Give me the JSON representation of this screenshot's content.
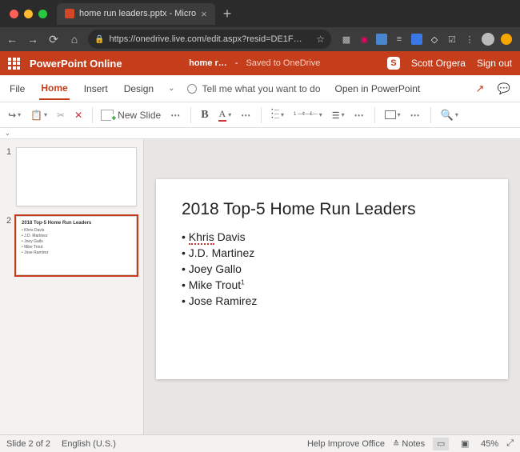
{
  "browser": {
    "tab_title": "home run leaders.pptx - Micro",
    "url": "https://onedrive.live.com/edit.aspx?resid=DE1F…"
  },
  "app": {
    "name": "PowerPoint Online",
    "doc_name": "home r…",
    "save_dash": "-",
    "save_status": "Saved to OneDrive",
    "user": "Scott Orgera",
    "signout": "Sign out"
  },
  "ribbon_tabs": {
    "file": "File",
    "home": "Home",
    "insert": "Insert",
    "design": "Design",
    "tellme": "Tell me what you want to do",
    "open_app": "Open in PowerPoint"
  },
  "ribbon": {
    "new_slide": "New Slide"
  },
  "slide": {
    "title": "2018 Top-5 Home Run Leaders",
    "items": [
      {
        "text_pre": "",
        "marked": "Khris",
        "text_post": " Davis",
        "sup": ""
      },
      {
        "text_pre": "J.D. Martinez",
        "marked": "",
        "text_post": "",
        "sup": ""
      },
      {
        "text_pre": "Joey Gallo",
        "marked": "",
        "text_post": "",
        "sup": ""
      },
      {
        "text_pre": "Mike Trout",
        "marked": "",
        "text_post": "",
        "sup": "1"
      },
      {
        "text_pre": "Jose Ramirez",
        "marked": "",
        "text_post": "",
        "sup": ""
      }
    ]
  },
  "thumbs": {
    "n1": "1",
    "n2": "2",
    "mini_title": "2018 Top-5 Home Run Leaders",
    "mini_lines": [
      "• Khris Davis",
      "• J.D. Martinez",
      "• Joey Gallo",
      "• Mike Trout",
      "• Jose Ramirez"
    ]
  },
  "status": {
    "slide_of": "Slide 2 of 2",
    "lang": "English (U.S.)",
    "help": "Help Improve Office",
    "notes": "Notes",
    "zoom": "45%"
  },
  "substrip": {
    "fx": ""
  }
}
